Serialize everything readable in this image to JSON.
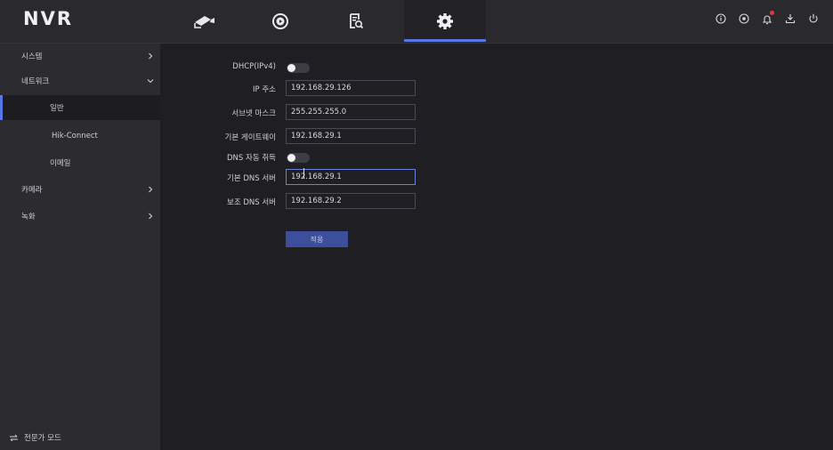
{
  "header": {
    "logo": "NVR",
    "tabs": [
      {
        "icon": "camera-icon",
        "active": false
      },
      {
        "icon": "playback-icon",
        "active": false
      },
      {
        "icon": "file-search-icon",
        "active": false
      },
      {
        "icon": "gear-icon",
        "active": true
      }
    ],
    "right_icons": [
      "info-icon",
      "record-icon",
      "alarm-bell-icon",
      "download-icon",
      "power-icon"
    ],
    "accent_color": "#5a76e6"
  },
  "sidebar": {
    "items": [
      {
        "label": "시스템",
        "expanded": false
      },
      {
        "label": "네트워크",
        "expanded": true
      },
      {
        "label": "일반",
        "sub": true,
        "active": true
      },
      {
        "label": "Hik-Connect",
        "sub": true
      },
      {
        "label": "이메일",
        "sub": true
      },
      {
        "label": "카메라",
        "expanded": false
      },
      {
        "label": "녹화",
        "expanded": false
      }
    ],
    "expert_mode": "전문가 모드"
  },
  "form": {
    "dhcp_label": "DHCP(IPv4)",
    "dhcp_enabled": false,
    "ip_label": "IP 주소",
    "ip_value": "192.168.29.126",
    "subnet_label": "서브넷 마스크",
    "subnet_value": "255.255.255.0",
    "gateway_label": "기본 게이트웨이",
    "gateway_value": "192.168.29.1",
    "dns_auto_label": "DNS 자동 취득",
    "dns_auto_enabled": false,
    "dns1_label": "기본 DNS 서버",
    "dns1_value": "192.168.29.1",
    "dns2_label": "보조 DNS 서버",
    "dns2_value": "192.168.29.2",
    "apply_label": "적용"
  }
}
